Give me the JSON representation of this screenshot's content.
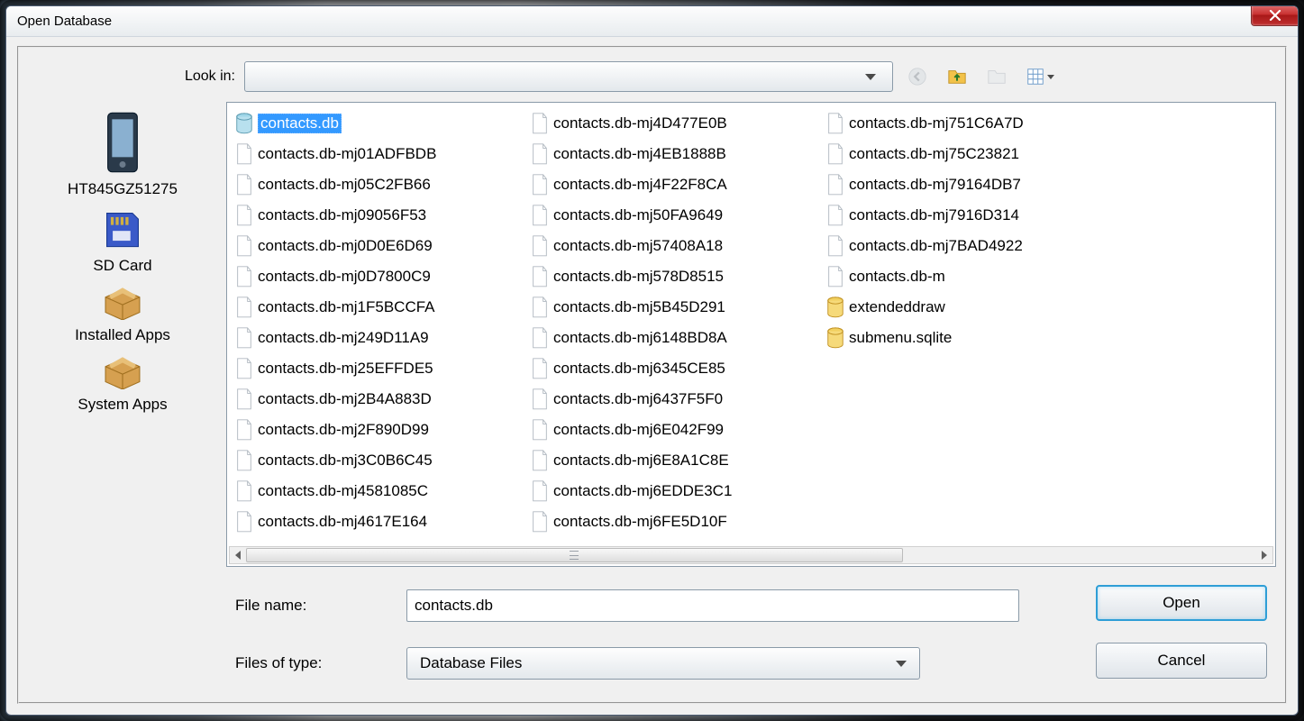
{
  "dialog": {
    "title": "Open Database",
    "lookin_label": "Look in:",
    "lookin_value": "",
    "filename_label": "File name:",
    "filename_value": "contacts.db",
    "filetype_label": "Files of type:",
    "filetype_value": "Database Files",
    "open_button": "Open",
    "cancel_button": "Cancel"
  },
  "places": [
    {
      "icon": "phone",
      "label": "HT845GZ51275"
    },
    {
      "icon": "sdcard",
      "label": "SD Card"
    },
    {
      "icon": "box",
      "label": "Installed Apps"
    },
    {
      "icon": "box",
      "label": "System Apps"
    }
  ],
  "files": [
    {
      "name": "contacts.db",
      "icon": "db",
      "selected": true
    },
    {
      "name": "contacts.db-mj01ADFBDB",
      "icon": "file"
    },
    {
      "name": "contacts.db-mj05C2FB66",
      "icon": "file"
    },
    {
      "name": "contacts.db-mj09056F53",
      "icon": "file"
    },
    {
      "name": "contacts.db-mj0D0E6D69",
      "icon": "file"
    },
    {
      "name": "contacts.db-mj0D7800C9",
      "icon": "file"
    },
    {
      "name": "contacts.db-mj1F5BCCFA",
      "icon": "file"
    },
    {
      "name": "contacts.db-mj249D11A9",
      "icon": "file"
    },
    {
      "name": "contacts.db-mj25EFFDE5",
      "icon": "file"
    },
    {
      "name": "contacts.db-mj2B4A883D",
      "icon": "file"
    },
    {
      "name": "contacts.db-mj2F890D99",
      "icon": "file"
    },
    {
      "name": "contacts.db-mj3C0B6C45",
      "icon": "file"
    },
    {
      "name": "contacts.db-mj4581085C",
      "icon": "file"
    },
    {
      "name": "contacts.db-mj4617E164",
      "icon": "file"
    },
    {
      "name": "contacts.db-mj4D477E0B",
      "icon": "file"
    },
    {
      "name": "contacts.db-mj4EB1888B",
      "icon": "file"
    },
    {
      "name": "contacts.db-mj4F22F8CA",
      "icon": "file"
    },
    {
      "name": "contacts.db-mj50FA9649",
      "icon": "file"
    },
    {
      "name": "contacts.db-mj57408A18",
      "icon": "file"
    },
    {
      "name": "contacts.db-mj578D8515",
      "icon": "file"
    },
    {
      "name": "contacts.db-mj5B45D291",
      "icon": "file"
    },
    {
      "name": "contacts.db-mj6148BD8A",
      "icon": "file"
    },
    {
      "name": "contacts.db-mj6345CE85",
      "icon": "file"
    },
    {
      "name": "contacts.db-mj6437F5F0",
      "icon": "file"
    },
    {
      "name": "contacts.db-mj6E042F99",
      "icon": "file"
    },
    {
      "name": "contacts.db-mj6E8A1C8E",
      "icon": "file"
    },
    {
      "name": "contacts.db-mj6EDDE3C1",
      "icon": "file"
    },
    {
      "name": "contacts.db-mj6FE5D10F",
      "icon": "file"
    },
    {
      "name": "contacts.db-mj751C6A7D",
      "icon": "file"
    },
    {
      "name": "contacts.db-mj75C23821",
      "icon": "file"
    },
    {
      "name": "contacts.db-mj79164DB7",
      "icon": "file"
    },
    {
      "name": "contacts.db-mj7916D314",
      "icon": "file"
    },
    {
      "name": "contacts.db-mj7BAD4922",
      "icon": "file"
    },
    {
      "name": "contacts.db-m",
      "icon": "file",
      "truncated": true
    },
    {
      "name": "extendeddraw",
      "icon": "db-yellow",
      "truncated": true
    },
    {
      "name": "submenu.sqlite",
      "icon": "db-yellow",
      "truncated": true
    }
  ]
}
